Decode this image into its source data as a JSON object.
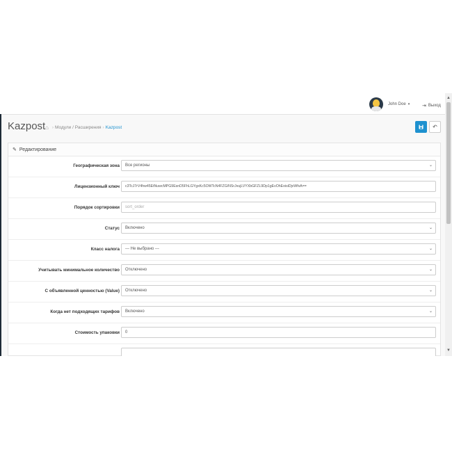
{
  "header": {
    "user_name": "John Doe",
    "user_caret": "▾",
    "logout_label": "Выход"
  },
  "page": {
    "title": "Kazpost",
    "breadcrumbs": [
      "Модули / Расширения",
      "Kazpost"
    ]
  },
  "panel": {
    "heading": "Редактирование"
  },
  "form": {
    "rows": [
      {
        "label": "Географическая зона",
        "value": "Все регионы",
        "type": "select"
      },
      {
        "label": "Лицензионный ключ",
        "value": "c3TcJ7rV4hw45EtNuwcMPG9EsnD5FhLGYgxKc5OWTcN4FZG/NSrJvujLVYXbGFZL9Dp1gEvOhEoisiDjvWfvA==",
        "type": "text"
      },
      {
        "label": "Порядок сортировки",
        "value": "",
        "placeholder": "sort_order",
        "type": "text"
      },
      {
        "label": "Статус",
        "value": "Включено",
        "type": "select"
      },
      {
        "label": "Класс налога",
        "value": "--- Не выбрано ---",
        "type": "select"
      },
      {
        "label": "Учитывать минимальное количество",
        "value": "Отключено",
        "type": "select"
      },
      {
        "label": "С объявленной ценностью (Value)",
        "value": "Отключено",
        "type": "select"
      },
      {
        "label": "Когда нет подходящих тарифов",
        "value": "Включено",
        "type": "select"
      },
      {
        "label": "Стоимость упаковки",
        "value": "0",
        "type": "text"
      },
      {
        "label": "",
        "value": "",
        "type": "text"
      }
    ]
  },
  "colors": {
    "primary": "#1e91cf",
    "sidebar": "#1e2b37"
  },
  "icons": {
    "home": "home-icon",
    "save": "save-icon",
    "back": "reply-icon",
    "edit": "pencil-icon",
    "logout": "sign-out-icon"
  }
}
